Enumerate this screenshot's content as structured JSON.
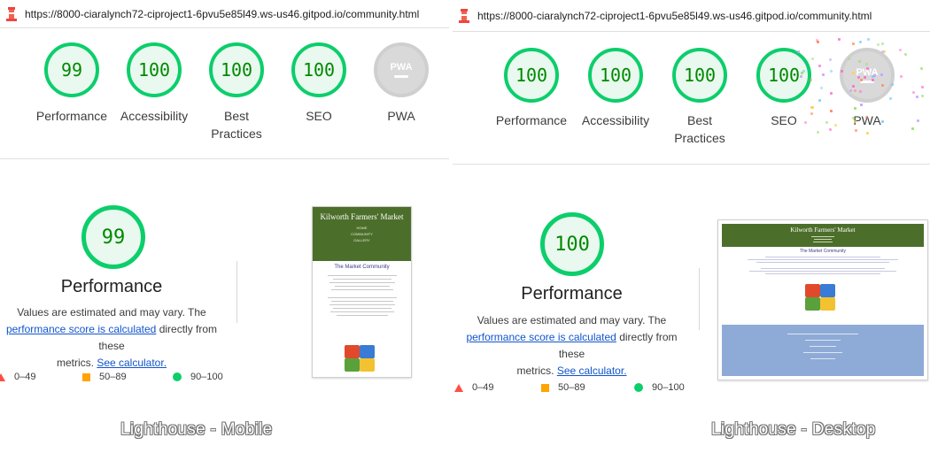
{
  "left": {
    "url": "https://8000-ciaralynch72-ciproject1-6pvu5e85l49.ws-us46.gitpod.io/community.html",
    "scores": [
      {
        "label": "Performance",
        "value": "99"
      },
      {
        "label": "Accessibility",
        "value": "100"
      },
      {
        "label": "Best Practices",
        "value": "100"
      },
      {
        "label": "SEO",
        "value": "100"
      },
      {
        "label": "PWA",
        "value": "PWA"
      }
    ],
    "main_score": "99",
    "main_title": "Performance",
    "caption": "Lighthouse - Mobile",
    "thumbnail": {
      "brand": "Kilworth Farmers' Market",
      "nav": [
        "HOME",
        "COMMUNITY",
        "GALLERY"
      ],
      "heading": "The Market Community"
    }
  },
  "right": {
    "url": "https://8000-ciaralynch72-ciproject1-6pvu5e85l49.ws-us46.gitpod.io/community.html",
    "scores": [
      {
        "label": "Performance",
        "value": "100"
      },
      {
        "label": "Accessibility",
        "value": "100"
      },
      {
        "label": "Best Practices",
        "value": "100"
      },
      {
        "label": "SEO",
        "value": "100"
      },
      {
        "label": "PWA",
        "value": "PWA"
      }
    ],
    "main_score": "100",
    "main_title": "Performance",
    "caption": "Lighthouse - Desktop",
    "thumbnail": {
      "brand": "Kilworth Farmers' Market",
      "heading": "The Market Community"
    }
  },
  "description": {
    "line1": "Values are estimated and may vary. The",
    "link1": "performance score is calculated",
    "line2": " directly from these",
    "line3": "metrics. ",
    "link2": "See calculator."
  },
  "legend": {
    "fail": "0–49",
    "average": "50–89",
    "pass": "90–100"
  },
  "colors": {
    "pass": "#0cce6b",
    "average": "#ffa400",
    "fail": "#ff4e42",
    "link": "#1155cc",
    "market_green": "#4c6e2b"
  }
}
